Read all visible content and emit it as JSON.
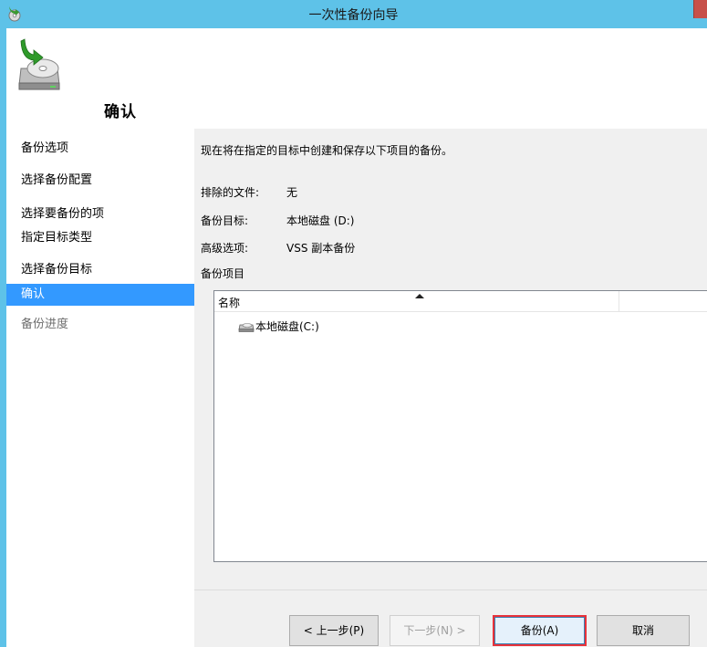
{
  "window": {
    "title": "一次性备份向导"
  },
  "header": {
    "title": "确认",
    "icon": "backup-disk-icon"
  },
  "sidebar": {
    "steps": [
      {
        "label": "备份选项",
        "state": "normal"
      },
      {
        "label": "选择备份配置",
        "state": "normal"
      },
      {
        "label": "选择要备份的项",
        "state": "normal"
      },
      {
        "label": "指定目标类型",
        "state": "normal"
      },
      {
        "label": "选择备份目标",
        "state": "normal"
      },
      {
        "label": "确认",
        "state": "active"
      },
      {
        "label": "备份进度",
        "state": "disabled"
      }
    ]
  },
  "content": {
    "intro": "现在将在指定的目标中创建和保存以下项目的备份。",
    "summary": [
      {
        "key": "排除的文件:",
        "value": "无"
      },
      {
        "key": "备份目标:",
        "value": "本地磁盘 (D:)"
      },
      {
        "key": "高级选项:",
        "value": "VSS 副本备份"
      }
    ],
    "items_label": "备份项目",
    "list": {
      "column_name": "名称",
      "items": [
        {
          "label": "本地磁盘(C:)",
          "icon": "drive-icon"
        }
      ]
    }
  },
  "footer": {
    "prev": "< 上一步(P)",
    "next": "下一步(N) >",
    "backup": "备份(A)",
    "cancel": "取消"
  },
  "colors": {
    "titlebar": "#5ec2e8",
    "active_step": "#3399ff",
    "highlight_border": "#e8323a"
  }
}
